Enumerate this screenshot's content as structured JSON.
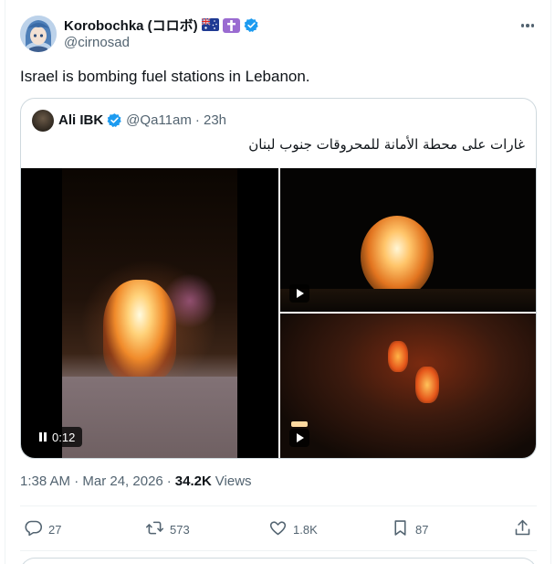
{
  "author": {
    "display_name": "Korobochka (コロボ)",
    "handle": "@cirnosad",
    "flag_icons": [
      "australia-flag-icon",
      "latin-cross-icon"
    ],
    "verified": true
  },
  "tweet": {
    "text": "Israel is bombing fuel stations in Lebanon.",
    "timestamp": "1:38 AM · Mar 24, 2026",
    "separator": "·",
    "views_count": "34.2K",
    "views_label": "Views"
  },
  "quoted": {
    "display_name": "Ali IBK",
    "handle": "@Qa11am",
    "age": "· 23h",
    "text": "غارات على محطة الأمانة للمحروقات جنوب لبنان",
    "video_time": "0:12"
  },
  "actions": {
    "replies": "27",
    "reposts": "573",
    "likes": "1.8K",
    "bookmarks": "87"
  },
  "colors": {
    "verified_blue": "#1d9bf0",
    "text_primary": "#0f1419",
    "text_secondary": "#536471",
    "border": "#cfd9de"
  }
}
